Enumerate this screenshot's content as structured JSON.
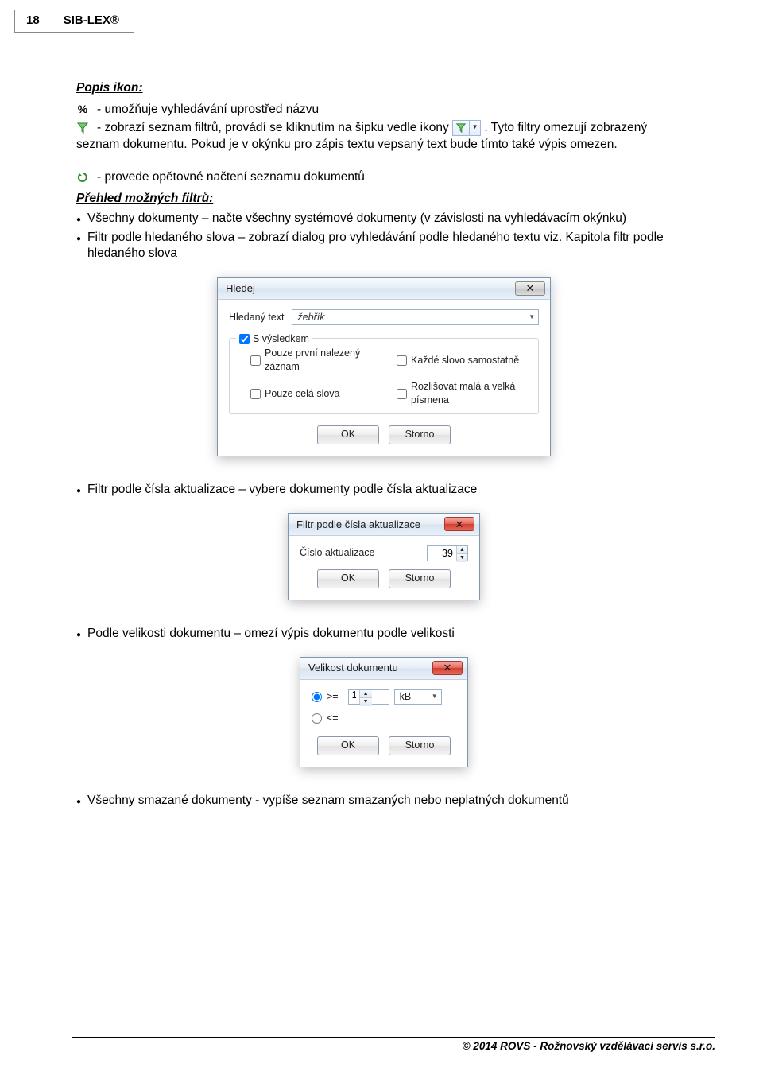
{
  "header": {
    "page_num": "18",
    "app_name": "SIB-LEX®"
  },
  "section": {
    "title": "Popis ikon:",
    "percent_desc": "- umožňuje vyhledávání uprostřed názvu",
    "funnel_desc_pre": "- zobrazí seznam filtrů, provádí se kliknutím na šipku vedle ikony ",
    "funnel_desc_post": ". Tyto filtry omezují zobrazený seznam dokumentu. Pokud je v okýnku pro zápis textu vepsaný text bude tímto také výpis omezen.",
    "refresh_desc": "- provede opětovné načtení seznamu dokumentů"
  },
  "filters": {
    "title": "Přehled možných filtrů:",
    "items": [
      "Všechny dokumenty – načte všechny systémové dokumenty (v závislosti na vyhledávacím okýnku)",
      "Filtr podle hledaného slova – zobrazí dialog pro vyhledávání podle hledaného textu viz. Kapitola filtr podle hledaného slova"
    ],
    "item_aktualizace": "Filtr podle čísla aktualizace – vybere dokumenty podle čísla aktualizace",
    "item_velikost": "Podle velikosti dokumentu – omezí výpis dokumentu podle velikosti",
    "item_smazane": "Všechny smazané dokumenty - vypíše seznam smazaných nebo neplatných dokumentů"
  },
  "dlg_hledej": {
    "title": "Hledej",
    "close_symbol": "✕",
    "label": "Hledaný text",
    "value": "žebřík",
    "group_label": "S výsledkem",
    "chk1": "Pouze první nalezený záznam",
    "chk2": "Každé slovo samostatně",
    "chk3": "Pouze celá slova",
    "chk4": "Rozlišovat malá a velká písmena",
    "ok": "OK",
    "cancel": "Storno"
  },
  "dlg_aktual": {
    "title": "Filtr podle čísla aktualizace",
    "close_symbol": "✕",
    "label": "Číslo aktualizace",
    "value": "39",
    "ok": "OK",
    "cancel": "Storno"
  },
  "dlg_velikost": {
    "title": "Velikost dokumentu",
    "close_symbol": "✕",
    "op_ge": ">=",
    "op_le": "<=",
    "value": "1",
    "unit": "kB",
    "ok": "OK",
    "cancel": "Storno"
  },
  "footer": "© 2014 ROVS - Rožnovský vzdělávací servis s.r.o."
}
